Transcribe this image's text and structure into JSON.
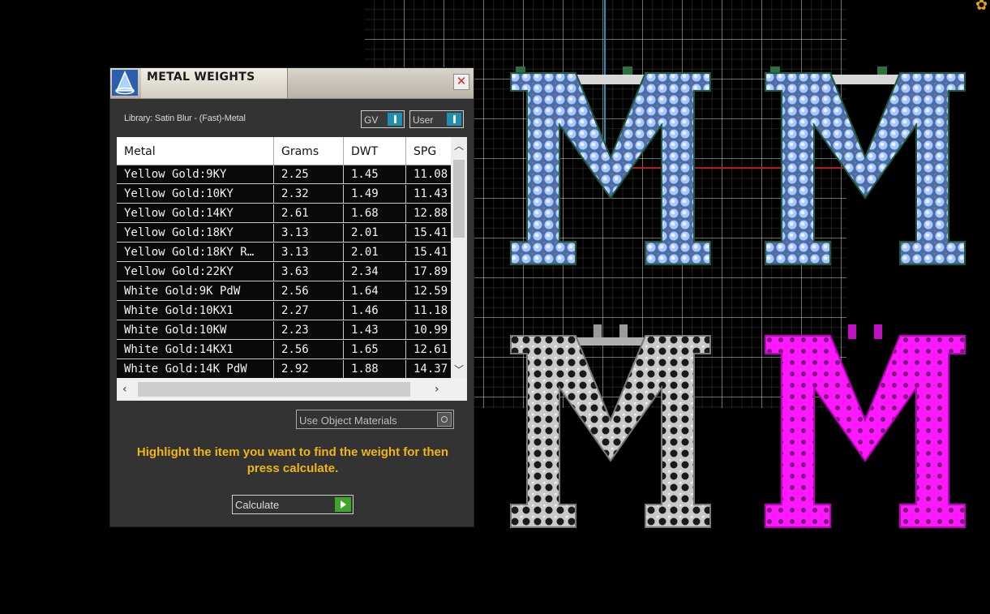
{
  "panel": {
    "title": "METAL WEIGHTS",
    "close_glyph": "✕",
    "library_label": "Library: Satin Blur - (Fast)-Metal",
    "gv_toggle_label": "GV",
    "user_toggle_label": "User",
    "table": {
      "headers": [
        "Metal",
        "Grams",
        "DWT",
        "SPG"
      ],
      "rows": [
        {
          "metal": "Yellow Gold:9KY",
          "grams": "2.25",
          "dwt": "1.45",
          "spg": "11.08"
        },
        {
          "metal": "Yellow Gold:10KY",
          "grams": "2.32",
          "dwt": "1.49",
          "spg": "11.43"
        },
        {
          "metal": "Yellow Gold:14KY",
          "grams": "2.61",
          "dwt": "1.68",
          "spg": "12.88"
        },
        {
          "metal": "Yellow Gold:18KY",
          "grams": "3.13",
          "dwt": "2.01",
          "spg": "15.41"
        },
        {
          "metal": "Yellow Gold:18KY R…",
          "grams": "3.13",
          "dwt": "2.01",
          "spg": "15.41"
        },
        {
          "metal": "Yellow Gold:22KY",
          "grams": "3.63",
          "dwt": "2.34",
          "spg": "17.89"
        },
        {
          "metal": "White Gold:9K PdW",
          "grams": "2.56",
          "dwt": "1.64",
          "spg": "12.59"
        },
        {
          "metal": "White Gold:10KX1",
          "grams": "2.27",
          "dwt": "1.46",
          "spg": "11.18"
        },
        {
          "metal": "White Gold:10KW",
          "grams": "2.23",
          "dwt": "1.43",
          "spg": "10.99"
        },
        {
          "metal": "White Gold:14KX1",
          "grams": "2.56",
          "dwt": "1.65",
          "spg": "12.61"
        },
        {
          "metal": "White Gold:14K PdW",
          "grams": "2.92",
          "dwt": "1.88",
          "spg": "14.37"
        }
      ]
    },
    "use_object_materials_label": "Use Object Materials",
    "instruction": "Highlight the item you want to find the weight for then press calculate.",
    "calculate_label": "Calculate"
  },
  "viewport": {
    "letter_char": "M",
    "letter_colors": {
      "blue_gem": "#7fa6e6",
      "silver": "#c9c9c9",
      "magenta": "#ff18ff"
    },
    "axis_colors": {
      "vertical": "#2a93b3",
      "horizontal": "#b02020"
    }
  }
}
